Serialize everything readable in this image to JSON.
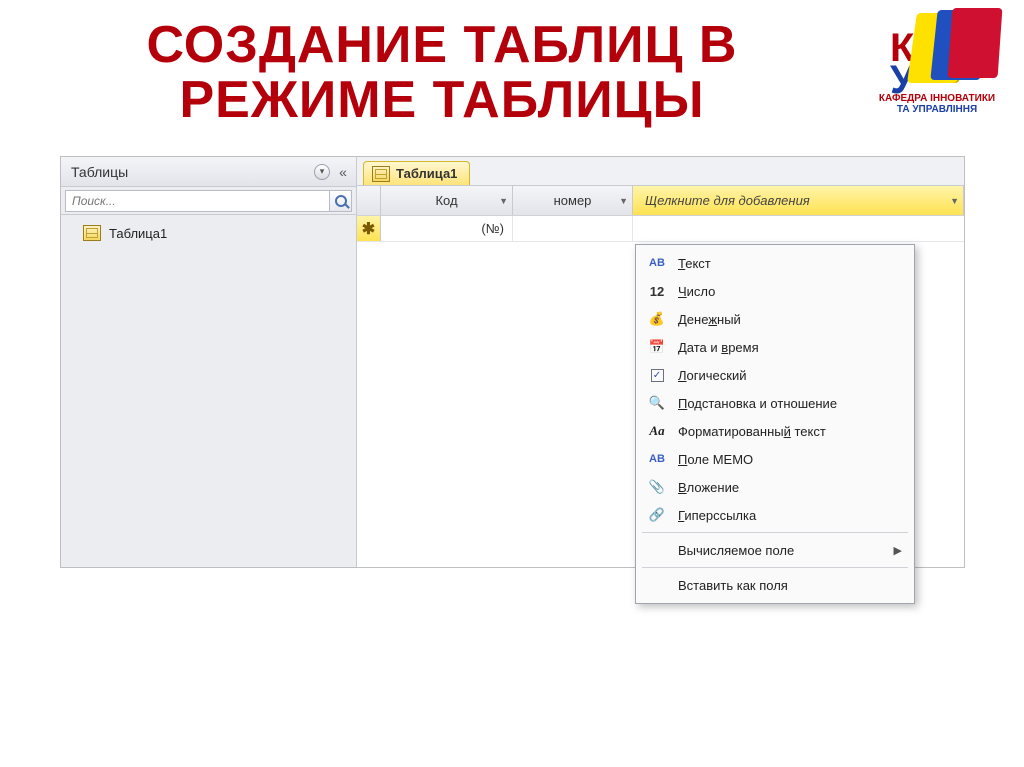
{
  "slide": {
    "title": "СОЗДАНИЕ ТАБЛИЦ В РЕЖИМЕ ТАБЛИЦЫ"
  },
  "logo": {
    "line1": "КАФЕДРА ІННОВАТИКИ",
    "line2": "ТА УПРАВЛІННЯ"
  },
  "nav": {
    "header": "Таблицы",
    "search_placeholder": "Поиск...",
    "items": [
      {
        "label": "Таблица1"
      }
    ]
  },
  "doc": {
    "tab_label": "Таблица1",
    "columns": {
      "kod": "Код",
      "nomer": "номер",
      "add": "Щелкните для добавления"
    },
    "row_new_glyph": "✱",
    "cell_kod_placeholder": "(№)"
  },
  "menu": {
    "items": [
      {
        "icon": "ab",
        "label": "Текст",
        "accel": "Т"
      },
      {
        "icon": "12",
        "label": "Число",
        "accel": "Ч"
      },
      {
        "icon": "money",
        "label": "Денежный",
        "accel": "ж"
      },
      {
        "icon": "date",
        "label": "Дата и время",
        "accel": "в"
      },
      {
        "icon": "check",
        "label": "Логический",
        "accel": "Л"
      },
      {
        "icon": "lookup",
        "label": "Подстановка и отношение",
        "accel": "П"
      },
      {
        "icon": "aa",
        "label": "Форматированный текст",
        "accel": "й"
      },
      {
        "icon": "ab",
        "label": "Поле МЕМО",
        "accel": "П"
      },
      {
        "icon": "clip",
        "label": "Вложение",
        "accel": "В"
      },
      {
        "icon": "link",
        "label": "Гиперссылка",
        "accel": "Г"
      }
    ],
    "calc": "Вычисляемое поле",
    "paste": "Вставить как поля"
  }
}
